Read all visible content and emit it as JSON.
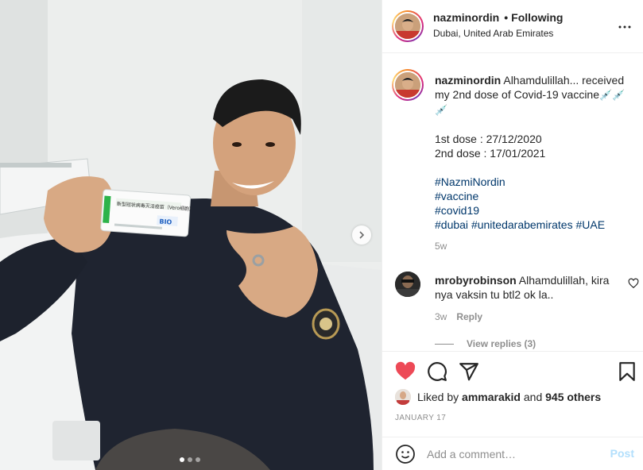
{
  "post": {
    "username": "nazminordin",
    "separator": "•",
    "follow_status": "Following",
    "location": "Dubai, United Arab Emirates"
  },
  "photo": {
    "vaccine_box_label": "新型冠状病毒灭活疫苗（Vero细胞）",
    "vaccine_box_brand": "BIO",
    "carousel_dots": 3,
    "active_dot": 1
  },
  "caption": {
    "username": "nazminordin",
    "text_lines": [
      "Alhamdulillah... received",
      "my 2nd dose of Covid-19 vaccine"
    ],
    "emoji": "💉",
    "dose1": "1st dose : 27/12/2020",
    "dose2": "2nd dose : 17/01/2021",
    "hashtags": [
      "#NazmiNordin",
      "#vaccine",
      "#covid19"
    ],
    "hashtag_line": [
      "#dubai",
      "#unitedarabemirates",
      "#UAE"
    ],
    "age": "5w"
  },
  "comment": {
    "username": "mrobyrobinson",
    "text_line1": "Alhamdulillah, kira",
    "text_line2": "nya vaksin tu btl2 ok la..",
    "age": "3w",
    "reply_label": "Reply",
    "view_replies": "View replies (3)"
  },
  "likes": {
    "prefix": "Liked by",
    "user": "ammarakid",
    "conjunction": "and",
    "others": "945 others"
  },
  "date": "JANUARY 17",
  "add_comment": {
    "placeholder": "Add a comment…",
    "post_label": "Post"
  },
  "colors": {
    "heart": "#ed4956",
    "hashtag": "#00376b",
    "muted": "#8e8e8e",
    "post_disabled": "#b2dffc"
  }
}
